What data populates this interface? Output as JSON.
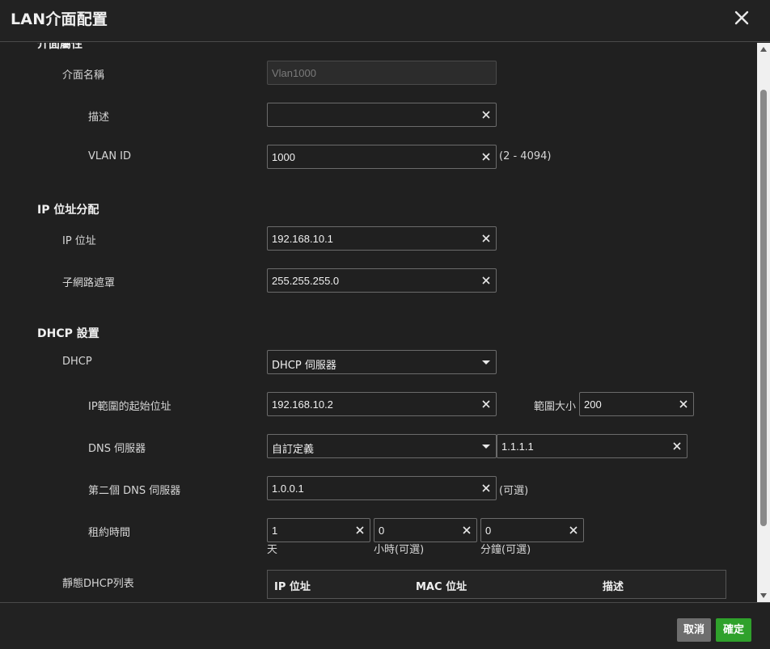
{
  "dialog": {
    "title": "LAN介面配置",
    "close_icon": "close-icon"
  },
  "interface_props": {
    "section_title": "介面屬性",
    "name_label": "介面名稱",
    "name_value": "Vlan1000",
    "desc_label": "描述",
    "desc_value": "",
    "vlan_label": "VLAN ID",
    "vlan_value": "1000",
    "vlan_hint": "(2 - 4094)"
  },
  "ip_assignment": {
    "section_title": "IP 位址分配",
    "ip_label": "IP 位址",
    "ip_value": "192.168.10.1",
    "mask_label": "子網路遮罩",
    "mask_value": "255.255.255.0"
  },
  "dhcp": {
    "section_title": "DHCP 設置",
    "dhcp_label": "DHCP",
    "dhcp_mode": "DHCP 伺服器",
    "range_start_label": "IP範圍的起始位址",
    "range_start_value": "192.168.10.2",
    "range_size_label": "範圍大小",
    "range_size_value": "200",
    "dns_label": "DNS 伺服器",
    "dns_mode": "自訂定義",
    "dns_value": "1.1.1.1",
    "dns2_label": "第二個 DNS 伺服器",
    "dns2_value": "1.0.0.1",
    "dns2_hint": "(可選)",
    "lease_label": "租約時間",
    "lease_days": "1",
    "lease_days_unit": "天",
    "lease_hours": "0",
    "lease_hours_unit": "小時(可選)",
    "lease_minutes": "0",
    "lease_minutes_unit": "分鐘(可選)",
    "static_label": "靜態DHCP列表",
    "table_headers": [
      "IP 位址",
      "MAC 位址",
      "描述"
    ]
  },
  "footer": {
    "cancel_label": "取消",
    "ok_label": "確定"
  },
  "colors": {
    "background": "#202020",
    "accent_ok": "#2fa12b",
    "cancel": "#6e6e6e"
  }
}
